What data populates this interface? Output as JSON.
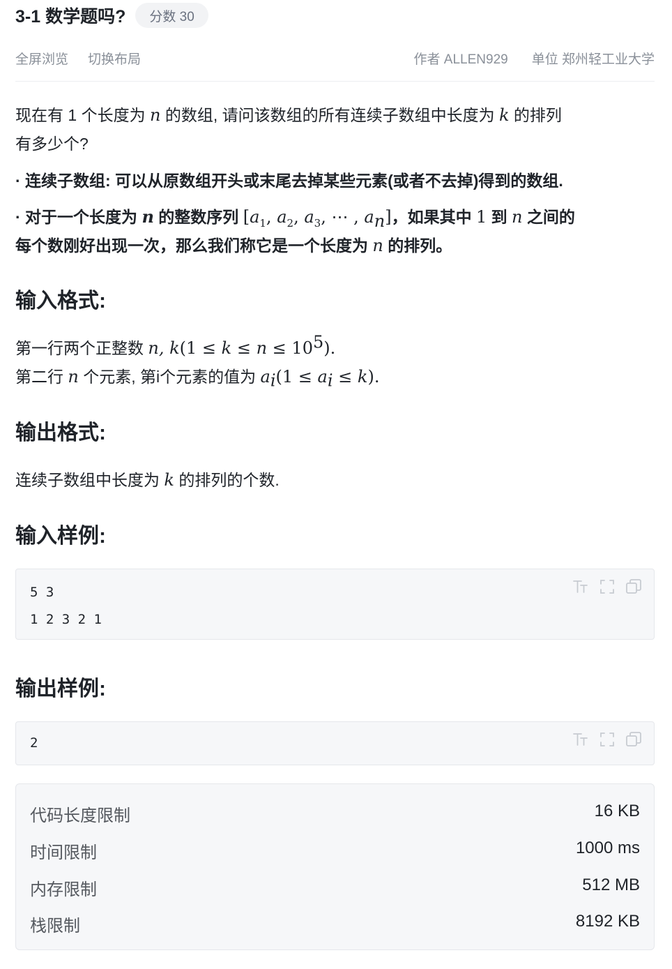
{
  "problem": {
    "title": "3-1 数学题吗?",
    "score_badge": "分数 30"
  },
  "meta": {
    "fullscreen_link": "全屏浏览",
    "layout_link": "切换布局",
    "author": "作者 ALLEN929",
    "unit": "单位 郑州轻工业大学"
  },
  "statement": {
    "intro_a": "现在有 1 个长度为 ",
    "n": "n",
    "intro_b": " 的数组, 请问该数组的所有连续子数组中长度为 ",
    "k": "k",
    "intro_c": " 的排列",
    "intro_d": "有多少个?",
    "bullet1": "· 连续子数组: 可以从原数组开头或末尾去掉某些元素(或者不去掉)得到的数组.",
    "bullet2_a": "· 对于一个长度为 ",
    "bullet2_b": " 的整数序列 ",
    "seq_open": "[",
    "seq_a": "a",
    "seq_sep": ",",
    "seq_dots": "⋯",
    "seq_close": "]",
    "sub_1": "1",
    "sub_2": "2",
    "sub_3": "3",
    "sub_n": "n",
    "bullet2_c": "，如果其中 ",
    "one": "1",
    "bullet2_d": " 到 ",
    "bullet2_e": " 之间的",
    "bullet2_line2_a": "每个数刚好出现一次，那么我们称它是一个长度为 ",
    "bullet2_line2_b": " 的排列。"
  },
  "input_format": {
    "heading": "输入格式:",
    "line1_text": "第一行两个正整数 ",
    "line1_math_a": "n, k",
    "line1_math_b": "(1 ≤ ",
    "line1_math_c": " ≤ ",
    "line1_math_d": "10",
    "line1_sup": "5",
    "line1_math_e": ").",
    "line2_text_a": "第二行 ",
    "line2_text_b": " 个元素, 第i个元素的值为 ",
    "line2_math_i": "i",
    "line2_paren_open": "(1 ≤ ",
    "line2_le": " ≤ ",
    "line2_paren_close": ")."
  },
  "output_format": {
    "heading": "输出格式:",
    "text_a": "连续子数组中长度为 ",
    "text_b": " 的排列的个数."
  },
  "sample_input": {
    "heading": "输入样例:",
    "code": "5 3\n1 2 3 2 1"
  },
  "sample_output": {
    "heading": "输出样例:",
    "code": "2"
  },
  "code_tools": [
    "font-size-icon",
    "fullscreen-icon",
    "copy-icon"
  ],
  "limits": [
    {
      "label": "代码长度限制",
      "value": "16 KB"
    },
    {
      "label": "时间限制",
      "value": "1000 ms"
    },
    {
      "label": "内存限制",
      "value": "512 MB"
    },
    {
      "label": "栈限制",
      "value": "8192 KB"
    }
  ],
  "colors": {
    "text": "#1f2329",
    "muted": "#8a9099",
    "badge_bg": "#f2f3f5",
    "code_bg": "#f6f7f9",
    "border": "#e5e7eb",
    "icon": "#c7cbd1"
  }
}
